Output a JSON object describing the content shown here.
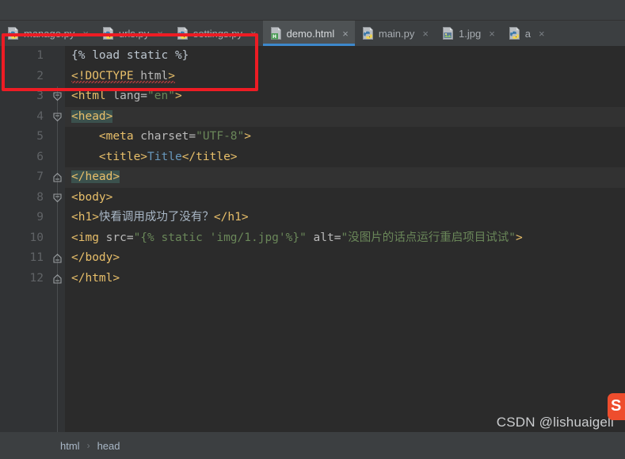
{
  "window": {
    "theme": "darcula",
    "accent_tab_underline": "#3d88cc",
    "annotation_color": "#ed1c24"
  },
  "tabs": [
    {
      "label": "manage.py",
      "icon": "python-file-icon",
      "active": false,
      "close_label": "×"
    },
    {
      "label": "urls.py",
      "icon": "python-file-icon",
      "active": false,
      "close_label": "×"
    },
    {
      "label": "settings.py",
      "icon": "python-file-icon",
      "active": false,
      "close_label": "×"
    },
    {
      "label": "demo.html",
      "icon": "html-file-icon",
      "active": true,
      "close_label": "×"
    },
    {
      "label": "main.py",
      "icon": "python-file-icon",
      "active": false,
      "close_label": "×"
    },
    {
      "label": "1.jpg",
      "icon": "image-file-icon",
      "active": false,
      "close_label": "×"
    },
    {
      "label": "a",
      "icon": "python-file-icon",
      "active": false,
      "close_label": "×"
    }
  ],
  "editor": {
    "line_numbers": [
      "1",
      "2",
      "3",
      "4",
      "5",
      "6",
      "7",
      "8",
      "9",
      "10",
      "11",
      "12"
    ],
    "lines": [
      {
        "n": "1",
        "text": "{% load static %}"
      },
      {
        "n": "2",
        "text": "<!DOCTYPE html>"
      },
      {
        "n": "3",
        "text": "<html lang=\"en\">"
      },
      {
        "n": "4",
        "text": "<head>"
      },
      {
        "n": "5",
        "text": "    <meta charset=\"UTF-8\">"
      },
      {
        "n": "6",
        "text": "    <title>Title</title>"
      },
      {
        "n": "7",
        "text": "</head>"
      },
      {
        "n": "8",
        "text": "<body>"
      },
      {
        "n": "9",
        "text": "<h1>快看调用成功了没有？</h1>"
      },
      {
        "n": "10",
        "text": "<img src=\"{% static 'img/1.jpg'%}\" alt=\"没图片的话点运行重启项目试试\">"
      },
      {
        "n": "11",
        "text": "</body>"
      },
      {
        "n": "12",
        "text": "</html>"
      }
    ],
    "segments": {
      "l1": [
        {
          "t": "{% load static %}",
          "c": "plain"
        }
      ],
      "l2": [
        {
          "t": "<!",
          "c": "tag"
        },
        {
          "t": "DOCTYPE",
          "c": "doctype"
        },
        {
          "t": " html",
          "c": "attr"
        },
        {
          "t": ">",
          "c": "tag"
        }
      ],
      "l3": [
        {
          "t": "<html",
          "c": "tag"
        },
        {
          "t": " lang=",
          "c": "attr"
        },
        {
          "t": "\"en\"",
          "c": "val"
        },
        {
          "t": ">",
          "c": "tag"
        }
      ],
      "l4": [
        {
          "t": "<head>",
          "c": "tag hl"
        }
      ],
      "l5": [
        {
          "t": "    ",
          "c": "txt"
        },
        {
          "t": "<meta",
          "c": "tag"
        },
        {
          "t": " charset=",
          "c": "attr"
        },
        {
          "t": "\"UTF-8\"",
          "c": "val"
        },
        {
          "t": ">",
          "c": "tag"
        }
      ],
      "l6": [
        {
          "t": "    ",
          "c": "txt"
        },
        {
          "t": "<title>",
          "c": "tag"
        },
        {
          "t": "Title",
          "c": "inner"
        },
        {
          "t": "</title>",
          "c": "tag"
        }
      ],
      "l7": [
        {
          "t": "</head>",
          "c": "tag hl"
        }
      ],
      "l8": [
        {
          "t": "<body>",
          "c": "tag"
        }
      ],
      "l9": [
        {
          "t": "<h1>",
          "c": "tag"
        },
        {
          "t": "快看调用成功了没有？",
          "c": "txt"
        },
        {
          "t": "</h1>",
          "c": "tag"
        }
      ],
      "l10": [
        {
          "t": "<img",
          "c": "tag"
        },
        {
          "t": " src=",
          "c": "attr"
        },
        {
          "t": "\"{% static 'img/1.jpg'%}\"",
          "c": "val"
        },
        {
          "t": " alt=",
          "c": "attr"
        },
        {
          "t": "\"没图片的话点运行重启项目试试\"",
          "c": "val"
        },
        {
          "t": ">",
          "c": "tag"
        }
      ],
      "l11": [
        {
          "t": "</body>",
          "c": "tag"
        }
      ],
      "l12": [
        {
          "t": "</html>",
          "c": "tag"
        }
      ]
    },
    "fold_markers": [
      {
        "line": 3,
        "type": "open"
      },
      {
        "line": 4,
        "type": "open"
      },
      {
        "line": 7,
        "type": "close"
      },
      {
        "line": 8,
        "type": "open"
      },
      {
        "line": 11,
        "type": "close"
      },
      {
        "line": 12,
        "type": "close"
      }
    ],
    "highlighted_lines": [
      4,
      7
    ],
    "caret_line": 4,
    "error_underline_line": 2
  },
  "breadcrumb": {
    "items": [
      "html",
      "head"
    ],
    "separator": "›"
  },
  "watermark": {
    "text": "CSDN @lishuaigell"
  },
  "badge": {
    "glyph": "S",
    "color": "#ee4d2d",
    "name": "shopee-badge"
  }
}
